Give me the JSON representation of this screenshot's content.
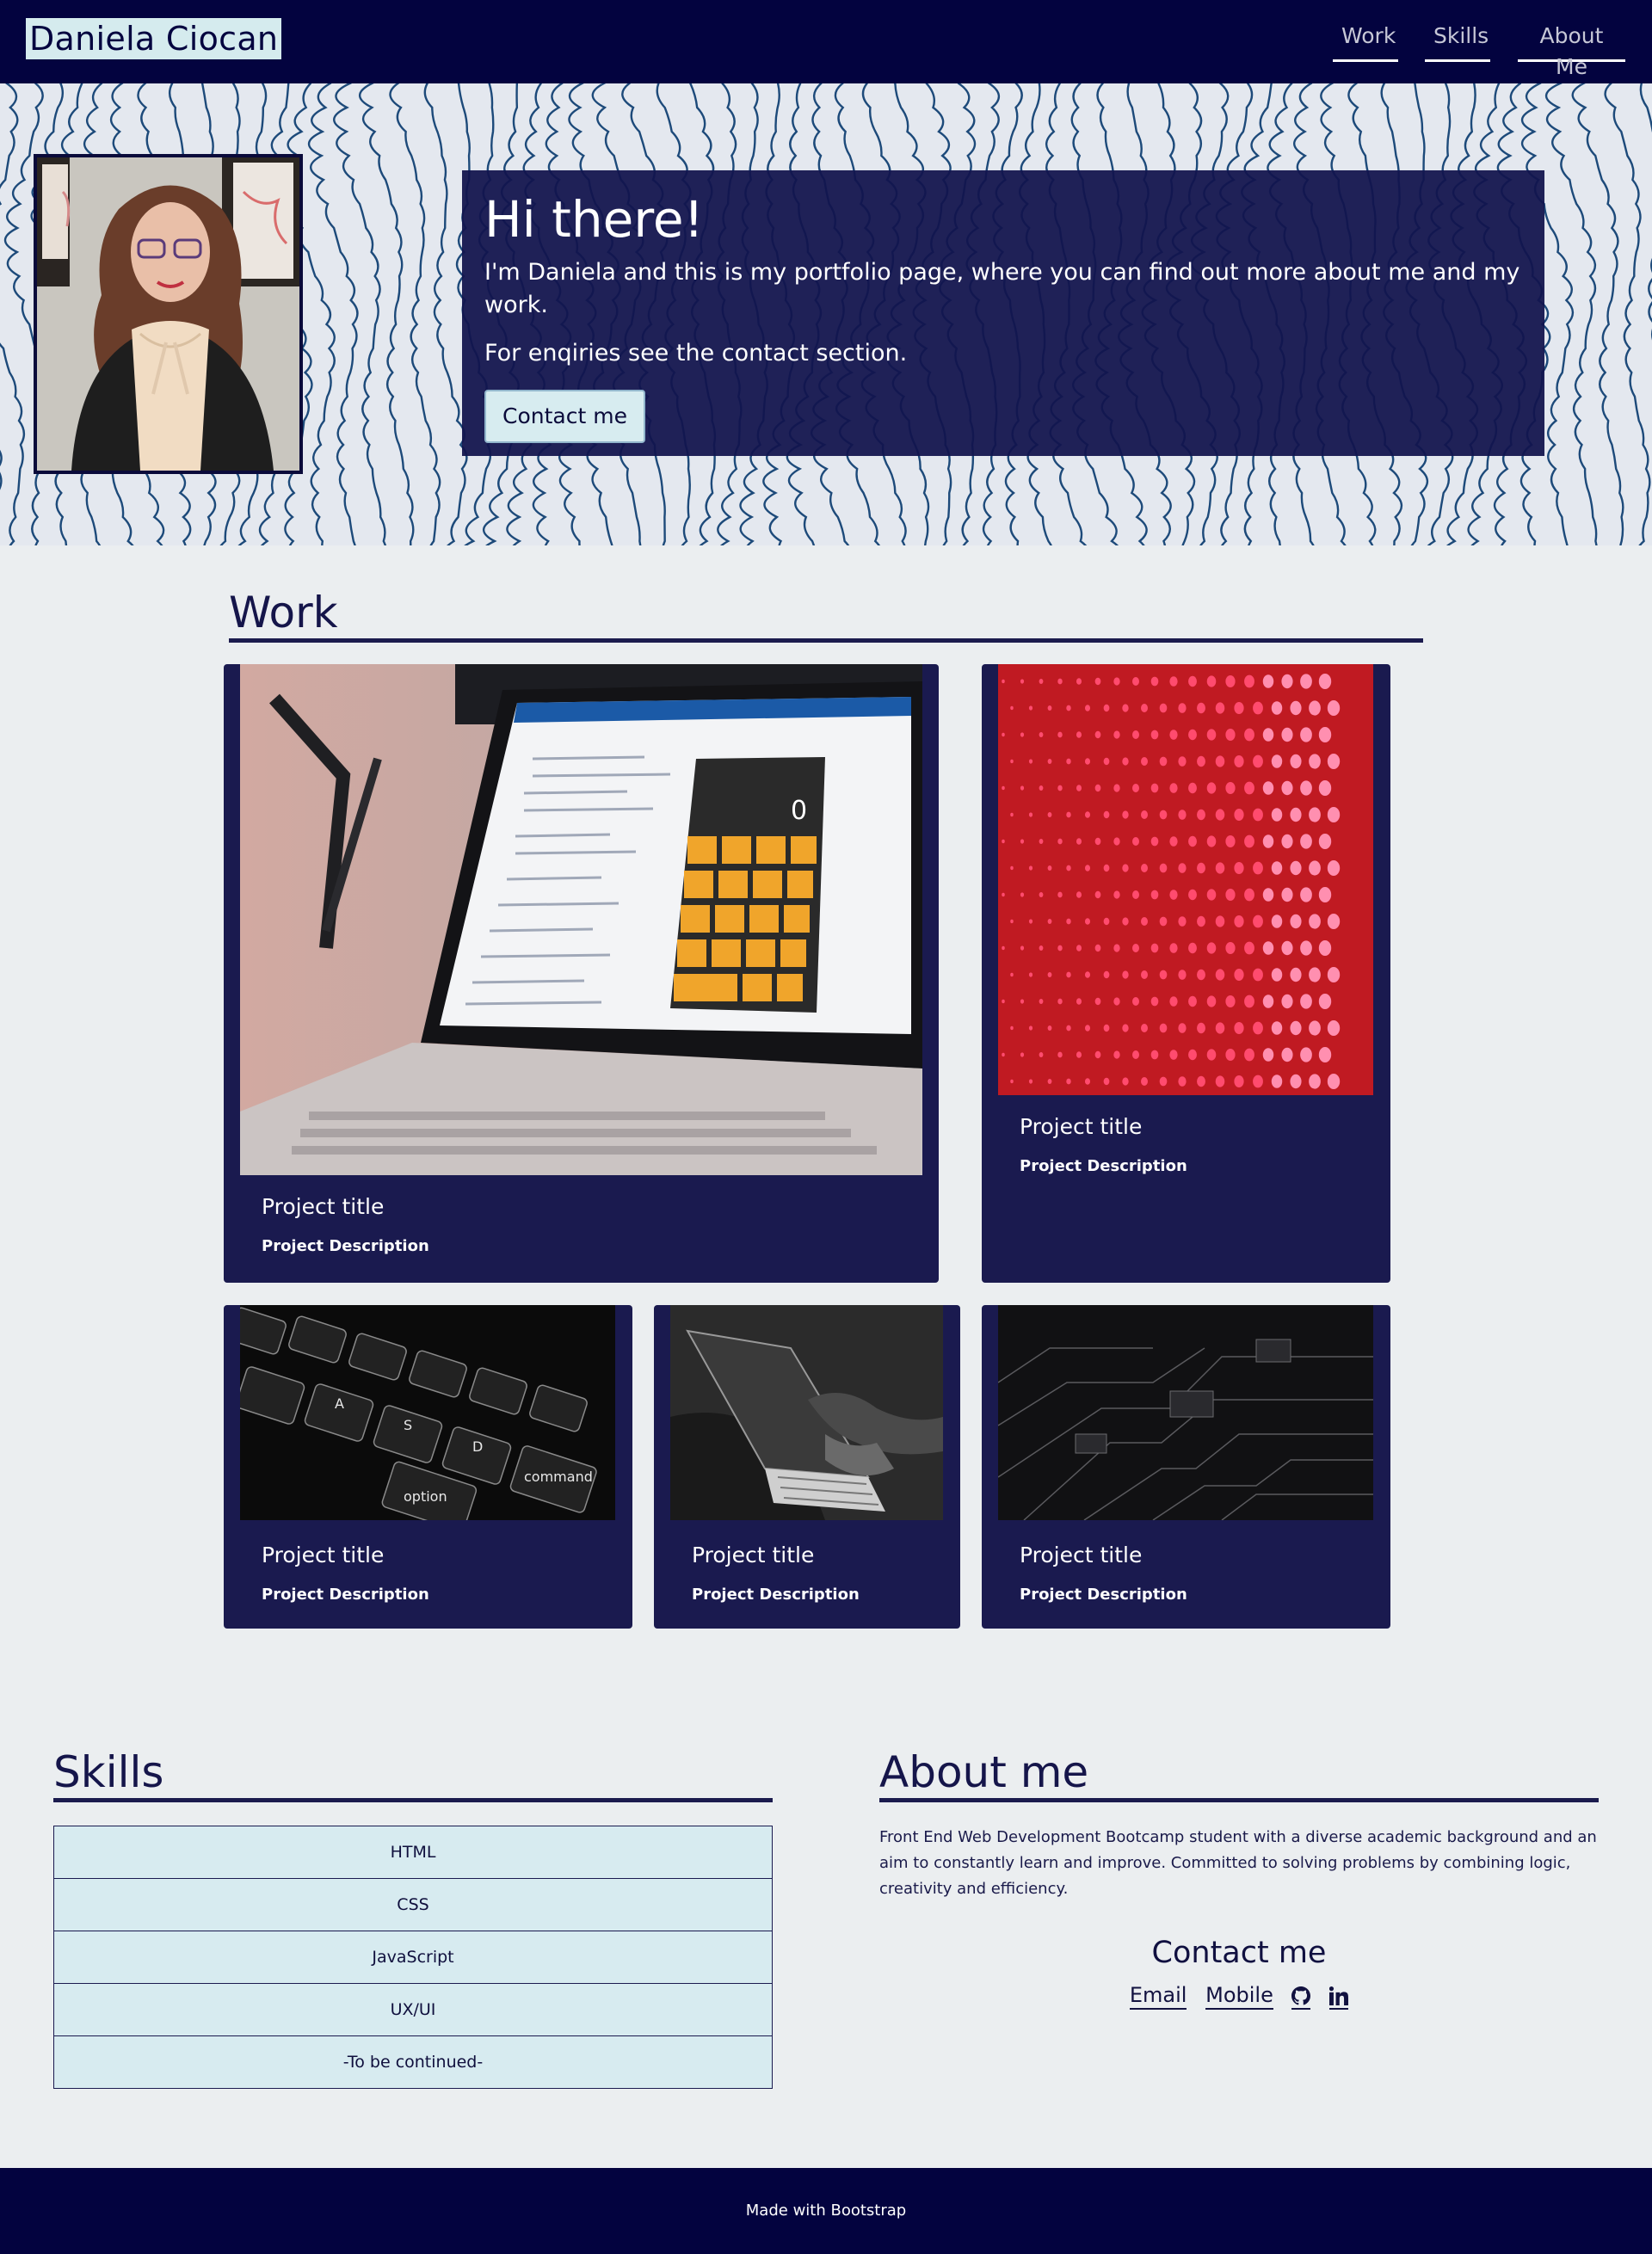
{
  "navbar": {
    "brand": "Daniela Ciocan",
    "links": [
      {
        "label": "Work"
      },
      {
        "label": "Skills"
      },
      {
        "label": "About Me"
      }
    ]
  },
  "hero": {
    "title": "Hi there!",
    "intro": "I'm Daniela and this is my portfolio page, where you can find out more about me and my work.",
    "enquiries": "For enqiries see the contact section.",
    "cta_label": "Contact me"
  },
  "work": {
    "title": "Work",
    "projects": [
      {
        "title": "Project title",
        "description": "Project Description",
        "image": "laptop-calculator-app"
      },
      {
        "title": "Project title",
        "description": "Project Description",
        "image": "red-led-wall"
      },
      {
        "title": "Project title",
        "description": "Project Description",
        "image": "keyboard-closeup"
      },
      {
        "title": "Project title",
        "description": "Project Description",
        "image": "hands-typing-laptop"
      },
      {
        "title": "Project title",
        "description": "Project Description",
        "image": "circuit-board"
      }
    ]
  },
  "skills": {
    "title": "Skills",
    "items": [
      "HTML",
      "CSS",
      "JavaScript",
      "UX/UI",
      "-To be continued-"
    ]
  },
  "about": {
    "title": "About me",
    "text": "Front End Web Development Bootcamp student with a diverse academic background and an aim to constantly learn and improve. Committed to solving problems by combining logic, creativity and efficiency.",
    "contact_title": "Contact me",
    "contact_links": {
      "email": "Email",
      "mobile": "Mobile",
      "github_icon": "github-icon",
      "linkedin_icon": "linkedin-icon"
    }
  },
  "footer": {
    "text": "Made with Bootstrap"
  },
  "colors": {
    "navy": "#03033f",
    "card_bg": "#1a1a4f",
    "page_bg": "#ebeef0",
    "accent_light": "#d7ebf0"
  }
}
